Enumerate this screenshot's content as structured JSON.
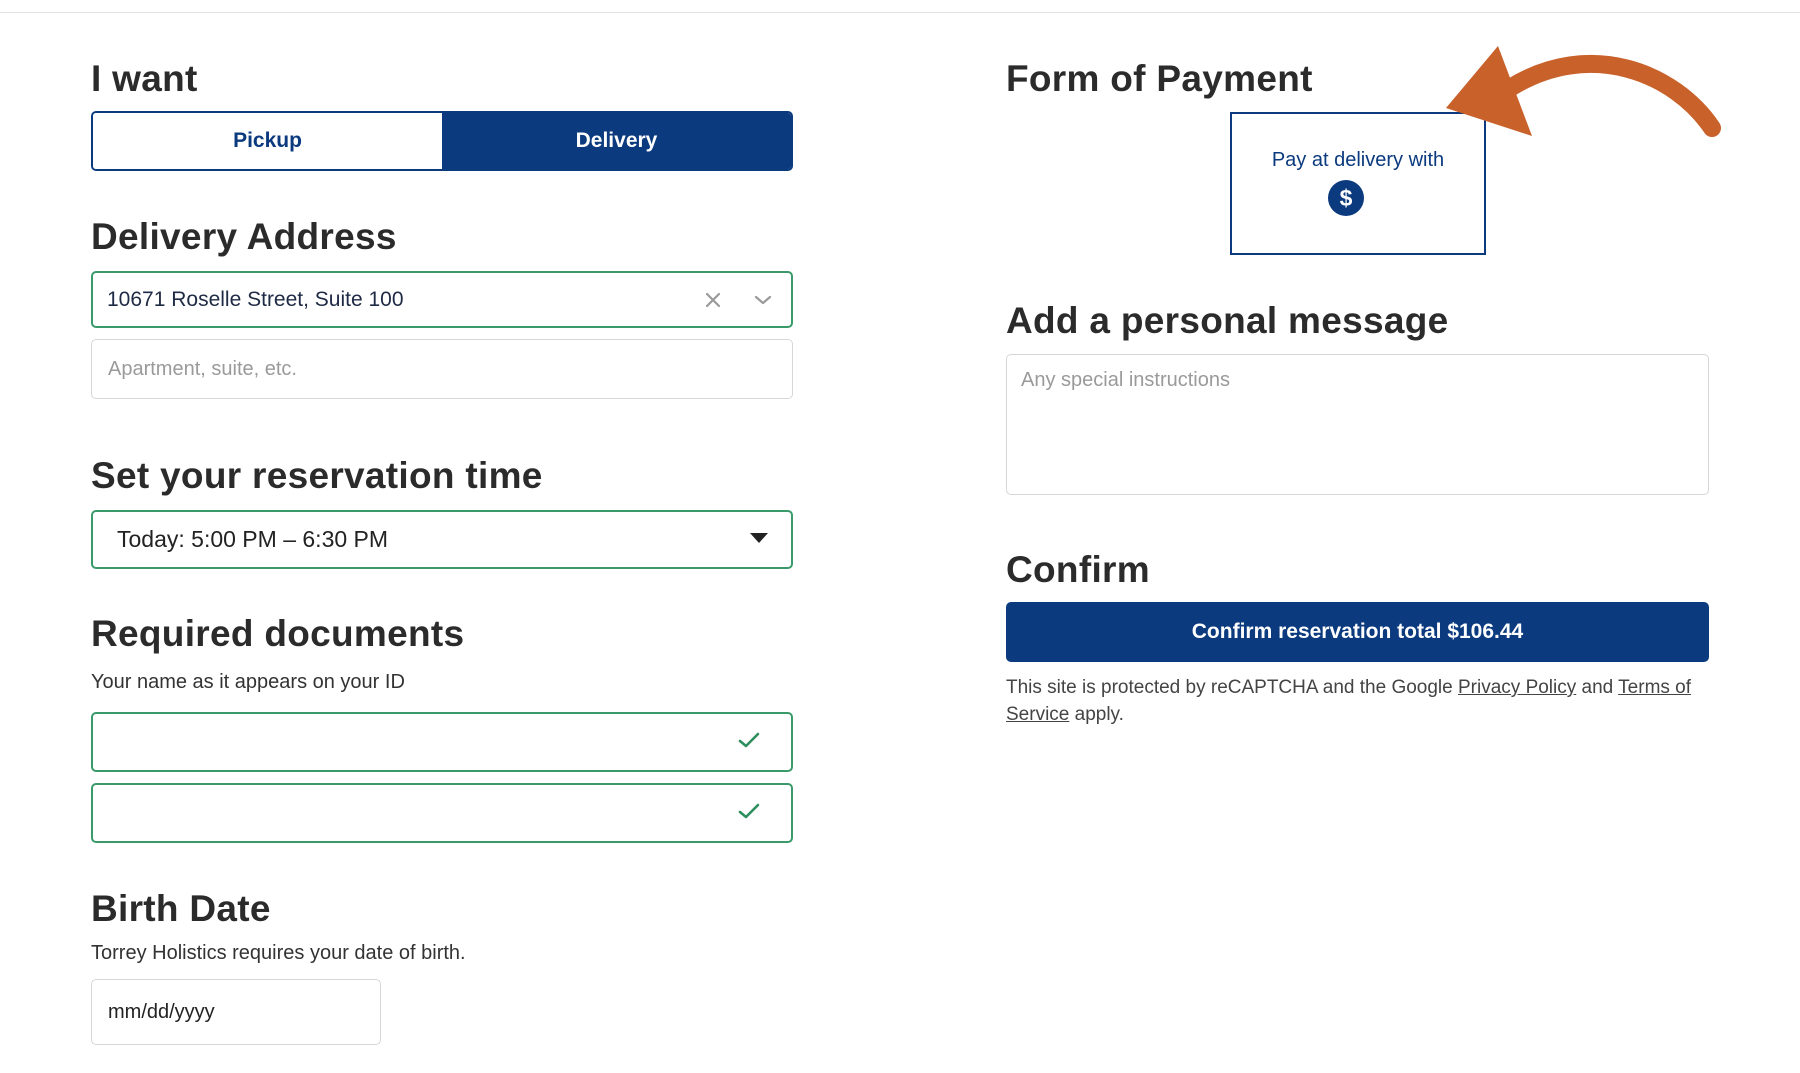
{
  "order": {
    "heading": "I want",
    "options": [
      "Pickup",
      "Delivery"
    ],
    "selected": "Delivery"
  },
  "delivery_address": {
    "heading": "Delivery Address",
    "value": "10671 Roselle Street, Suite 100",
    "apt_placeholder": "Apartment, suite, etc."
  },
  "reservation": {
    "heading": "Set your reservation time",
    "selected": "Today: 5:00 PM – 6:30 PM"
  },
  "documents": {
    "heading": "Required documents",
    "hint": "Your name as it appears on your ID"
  },
  "birth_date": {
    "heading": "Birth Date",
    "hint": "Torrey Holistics requires your date of birth.",
    "placeholder": "mm/dd/yyyy"
  },
  "payment": {
    "heading": "Form of Payment",
    "option_label": "Pay at delivery with",
    "option_icon": "dollar-coin-icon"
  },
  "message": {
    "heading": "Add a personal message",
    "placeholder": "Any special instructions"
  },
  "confirm": {
    "heading": "Confirm",
    "button_label": "Confirm reservation total $106.44",
    "legal_prefix": "This site is protected by reCAPTCHA and the Google ",
    "privacy_link": "Privacy Policy",
    "legal_and": " and ",
    "terms_link": "Terms of Service",
    "legal_suffix": " apply."
  },
  "colors": {
    "primary": "#0b3a7e",
    "valid_border": "#3a9a6a",
    "annotation_arrow": "#c8612a"
  },
  "annotation": {
    "icon": "curved-arrow-icon"
  }
}
